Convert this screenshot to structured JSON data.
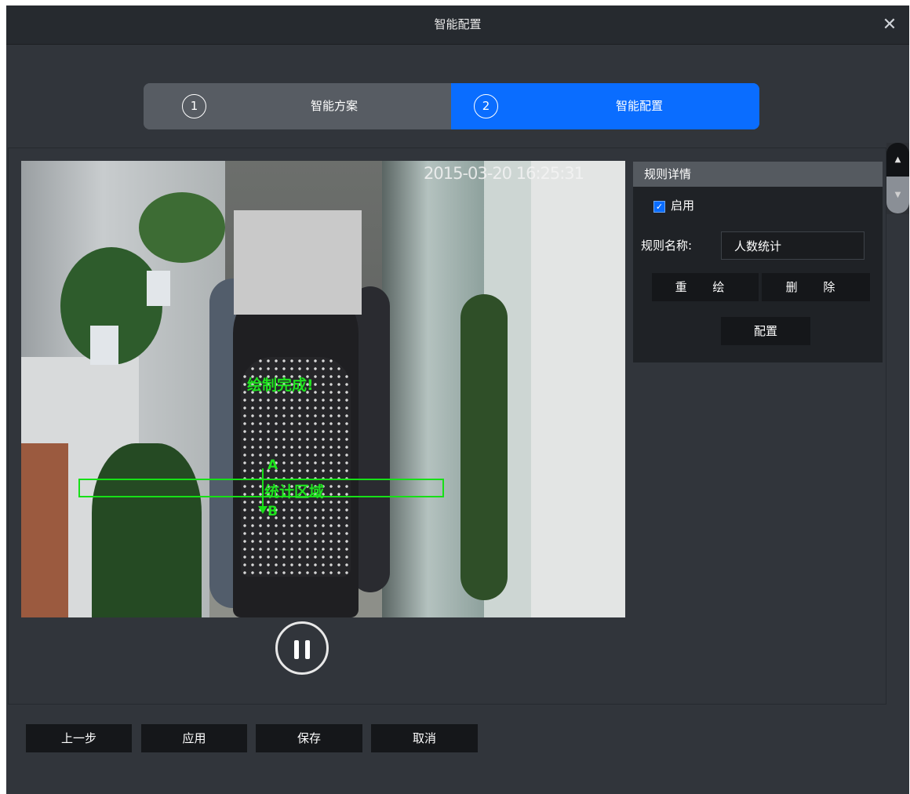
{
  "window": {
    "title": "智能配置",
    "close_icon": "close-icon"
  },
  "steps": [
    {
      "number": "1",
      "label": "智能方案",
      "active": false
    },
    {
      "number": "2",
      "label": "智能配置",
      "active": true
    }
  ],
  "video": {
    "timestamp": "2015-03-20 16:25:31",
    "draw_message": "绘制完成!",
    "area_label": "统计区域",
    "direction_start": "A",
    "direction_end": "B",
    "overlay_color": "#17e017",
    "pause_icon": "pause-icon"
  },
  "rule_panel": {
    "title": "规则详情",
    "enable_label": "启用",
    "enabled": true,
    "name_label": "规则名称:",
    "name_value": "人数统计",
    "redraw_label": "重 绘",
    "delete_label": "删 除",
    "config_label": "配置"
  },
  "footer": {
    "prev_label": "上一步",
    "apply_label": "应用",
    "save_label": "保存",
    "cancel_label": "取消"
  },
  "colors": {
    "accent": "#0a6dff",
    "background": "#31353b",
    "titlebar": "#262a2f",
    "button": "#15171a"
  }
}
